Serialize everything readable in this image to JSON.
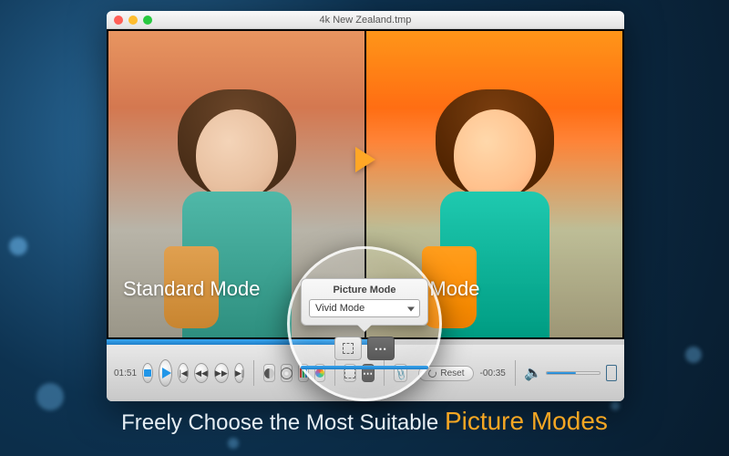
{
  "tagline": {
    "pre": "Freely Choose the Most Suitable ",
    "accent": "Picture Modes"
  },
  "window": {
    "title": "4k New Zealand.tmp"
  },
  "panes": {
    "left_label": "Standard Mode",
    "right_label": "Vivid Mode"
  },
  "popover": {
    "title": "Picture Mode",
    "selected": "Vivid Mode"
  },
  "controls": {
    "time_current": "01:51",
    "time_remaining": "-00:35",
    "reset_label": "Reset"
  }
}
